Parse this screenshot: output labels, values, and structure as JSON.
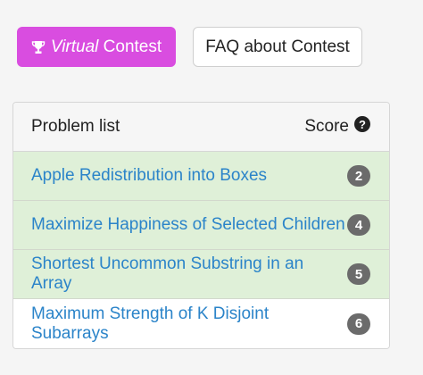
{
  "buttons": {
    "virtual_italic": "Virtual",
    "virtual_rest": "Contest",
    "faq": "FAQ about Contest"
  },
  "problem_list": {
    "header_left": "Problem list",
    "header_right": "Score",
    "help_icon_glyph": "?",
    "rows": [
      {
        "title": "Apple Redistribution into Boxes",
        "score": "2",
        "status": "solved"
      },
      {
        "title": "Maximize Happiness of Selected Children",
        "score": "4",
        "status": "solved"
      },
      {
        "title": "Shortest Uncommon Substring in an Array",
        "score": "5",
        "status": "solved"
      },
      {
        "title": "Maximum Strength of K Disjoint Subarrays",
        "score": "6",
        "status": "unsolved"
      }
    ]
  },
  "colors": {
    "virtual_button": "#d94de0",
    "solved_row": "#dff0d8",
    "link": "#2b84c9",
    "badge": "#6b6b6b"
  },
  "icons": {
    "virtual_button": "trophy-icon",
    "score_help": "question-circle-icon"
  }
}
